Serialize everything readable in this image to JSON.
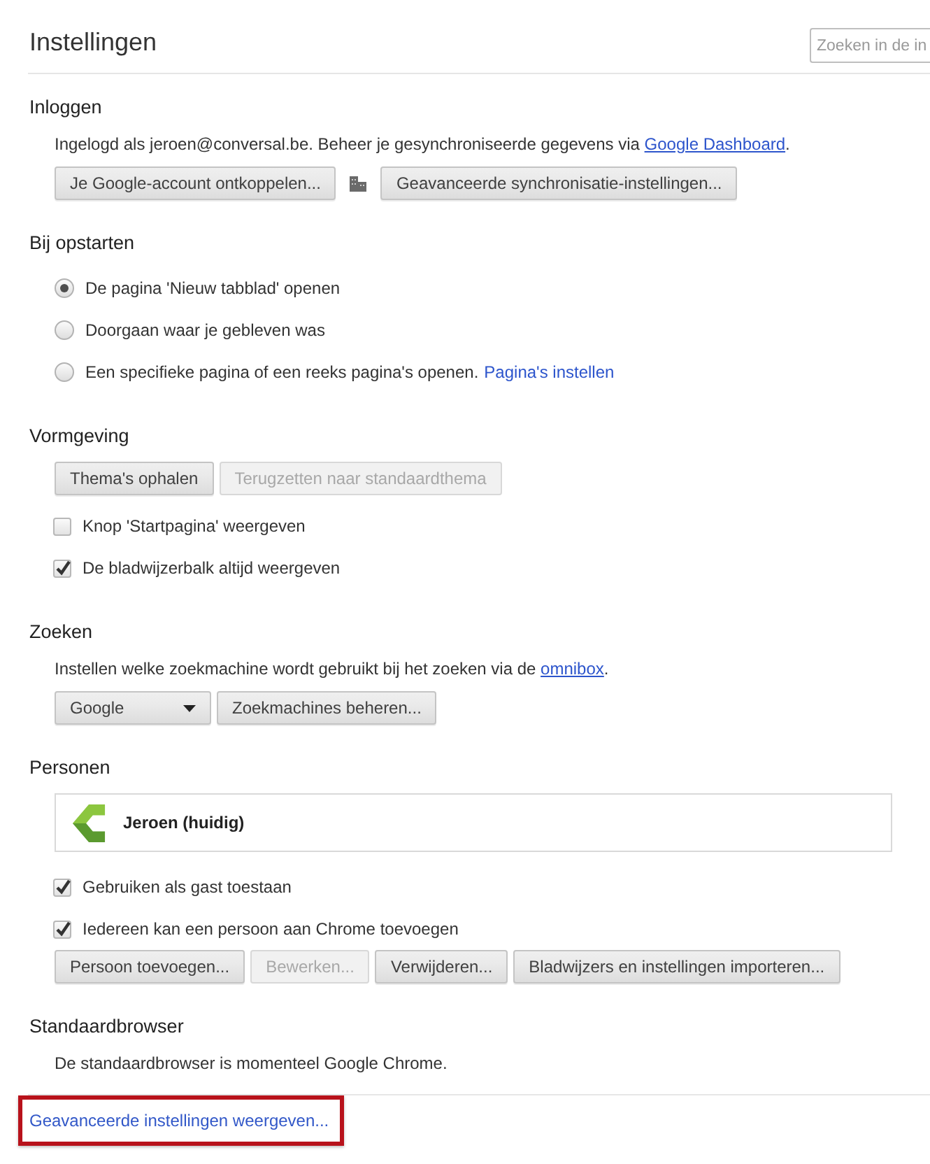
{
  "header": {
    "title": "Instellingen",
    "search": {
      "placeholder": "Zoeken in de in"
    }
  },
  "sections": [
    {
      "heading": "Inloggen",
      "blocks": [
        {
          "kind": "text",
          "text": "Ingelogd als jeroen@conversal.be. Beheer je gesynchroniseerde gegevens via",
          "link": "Google Dashboard",
          "end": "."
        },
        {
          "kind": "buttons",
          "items": [
            {
              "kind": "button",
              "label": "Je Google-account ontkoppelen...",
              "disabled": false
            },
            {
              "kind": "icon"
            },
            {
              "kind": "button",
              "label": "Geavanceerde synchronisatie-instellingen...",
              "disabled": false
            }
          ]
        }
      ]
    },
    {
      "heading": "Bij opstarten",
      "blocks": [
        {
          "kind": "radios",
          "items": [
            {
              "label": "De pagina 'Nieuw tabblad' openen",
              "selected": true
            },
            {
              "label": "Doorgaan waar je gebleven was",
              "selected": false
            },
            {
              "label": "Een specifieke pagina of een reeks pagina's openen.",
              "link": "Pagina's instellen",
              "selected": false
            }
          ]
        }
      ]
    },
    {
      "heading": "Vormgeving",
      "blocks": [
        {
          "kind": "buttons",
          "items": [
            {
              "kind": "button",
              "label": "Thema's ophalen",
              "disabled": false
            },
            {
              "kind": "button",
              "label": "Terugzetten naar standaardthema",
              "disabled": true
            }
          ]
        },
        {
          "kind": "checks",
          "items": [
            {
              "label": "Knop 'Startpagina' weergeven",
              "checked": false
            },
            {
              "label": "De bladwijzerbalk altijd weergeven",
              "checked": true
            }
          ]
        }
      ]
    },
    {
      "heading": "Zoeken",
      "blocks": [
        {
          "kind": "text",
          "text": "Instellen welke zoekmachine wordt gebruikt bij het zoeken via de",
          "link": "omnibox",
          "end": "."
        },
        {
          "kind": "buttons",
          "items": [
            {
              "kind": "dropdown",
              "value": "Google"
            },
            {
              "kind": "button",
              "label": "Zoekmachines beheren...",
              "disabled": false
            }
          ]
        }
      ]
    },
    {
      "heading": "Personen",
      "blocks": [
        {
          "kind": "profile",
          "name": "Jeroen (huidig)"
        },
        {
          "kind": "checks",
          "items": [
            {
              "label": "Gebruiken als gast toestaan",
              "checked": true
            },
            {
              "label": "Iedereen kan een persoon aan Chrome toevoegen",
              "checked": true
            }
          ]
        },
        {
          "kind": "buttons",
          "items": [
            {
              "kind": "button",
              "label": "Persoon toevoegen...",
              "disabled": false
            },
            {
              "kind": "button",
              "label": "Bewerken...",
              "disabled": true
            },
            {
              "kind": "button",
              "label": "Verwijderen...",
              "disabled": false
            },
            {
              "kind": "button",
              "label": "Bladwijzers en instellingen importeren...",
              "disabled": false
            }
          ]
        }
      ]
    },
    {
      "heading": "Standaardbrowser",
      "blocks": [
        {
          "kind": "text",
          "text": "De standaardbrowser is momenteel Google Chrome."
        }
      ]
    }
  ],
  "footer": {
    "link": "Geavanceerde instellingen weergeven...",
    "highlighted": true
  }
}
